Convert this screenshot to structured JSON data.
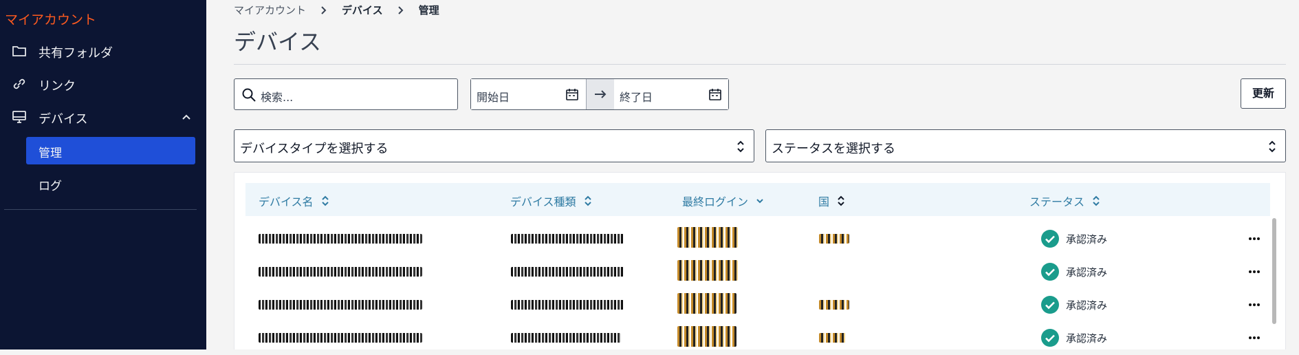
{
  "sidebar": {
    "brand": "マイアカウント",
    "items": [
      {
        "label": "共有フォルダ",
        "icon": "folder-icon"
      },
      {
        "label": "リンク",
        "icon": "link-icon"
      },
      {
        "label": "デバイス",
        "icon": "monitor-icon",
        "expanded": true
      }
    ],
    "sub_items": [
      {
        "label": "管理",
        "active": true
      },
      {
        "label": "ログ",
        "active": false
      }
    ]
  },
  "breadcrumb": [
    "マイアカウント",
    "デバイス",
    "管理"
  ],
  "page": {
    "title": "デバイス"
  },
  "filters": {
    "search_placeholder": "検索...",
    "start_date_placeholder": "開始日",
    "end_date_placeholder": "終了日",
    "refresh_label": "更新",
    "device_type_select": "デバイスタイプを選択する",
    "status_select": "ステータスを選択する"
  },
  "table": {
    "columns": [
      "デバイス名",
      "デバイス種類",
      "最終ログイン",
      "国",
      "ステータス"
    ],
    "rows": [
      {
        "status": "承認済み"
      },
      {
        "status": "承認済み"
      },
      {
        "status": "承認済み"
      },
      {
        "status": "承認済み"
      }
    ]
  },
  "colors": {
    "sidebar_bg": "#0c1533",
    "brand": "#ff5a1f",
    "active_item": "#1f4fd8",
    "table_header_text": "#2f7ba3",
    "status_ok": "#1a9c8c"
  }
}
